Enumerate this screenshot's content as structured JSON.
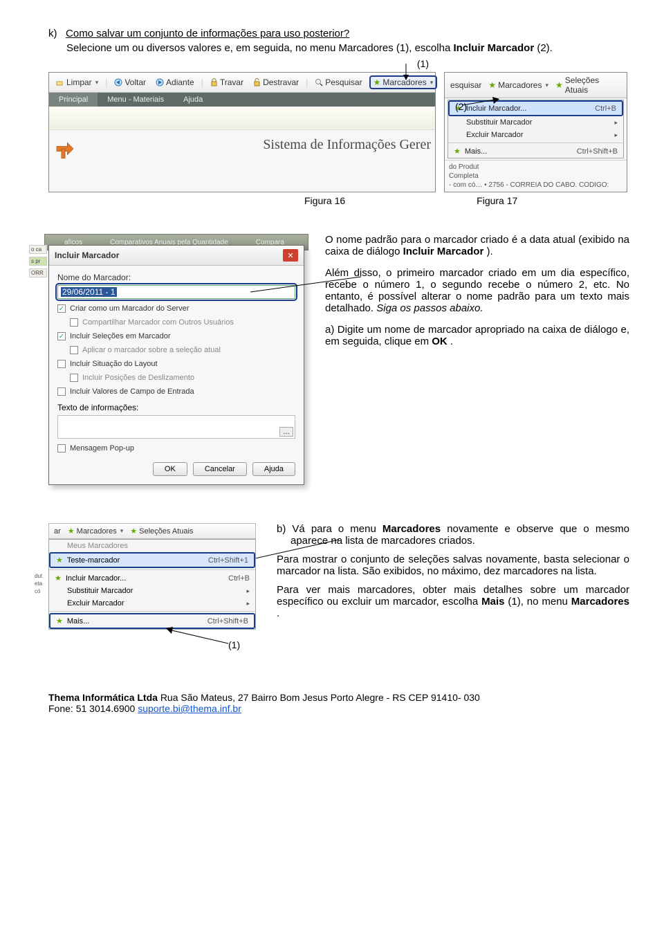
{
  "heading": {
    "k": "k)",
    "title": "Como salvar um conjunto de informações para uso posterior?",
    "intro_pre": "Selecione um ou diversos valores e, em seguida, no menu Marcadores (1), escolha ",
    "intro_bold": "Incluir Marcador",
    "intro_post": " (2)."
  },
  "callouts": {
    "c1": "(1)",
    "c2": "(2)"
  },
  "fig16": {
    "toolbar": {
      "limpar": "Limpar",
      "voltar": "Voltar",
      "adiante": "Adiante",
      "travar": "Travar",
      "destravar": "Destravar",
      "pesquisar": "Pesquisar",
      "marcadores": "Marcadores"
    },
    "tabs": {
      "principal": "Principal",
      "menu_mat": "Menu - Materiais",
      "ajuda": "Ajuda"
    },
    "sys_title": "Sistema de Informações Gerer",
    "caption": "Figura 16"
  },
  "fig17": {
    "top": {
      "pesquisar": "esquisar",
      "marcadores": "Marcadores",
      "selecoes": "Seleções Atuais"
    },
    "items": {
      "incluir": "Incluir Marcador...",
      "incluir_sc": "Ctrl+B",
      "substituir": "Substituir Marcador",
      "excluir": "Excluir Marcador",
      "mais": "Mais...",
      "mais_sc": "Ctrl+Shift+B"
    },
    "below": {
      "l1": "do Produt",
      "l2": "Completa",
      "l3": "- com có…    • 2756 - CORREIA DO CABO. CODIGO:"
    },
    "caption": "Figura 17"
  },
  "dialog": {
    "bg_tabs": {
      "t1": "aficos",
      "t2": "Comparativos Anuais pela Quantidade",
      "t3": "Compara"
    },
    "title": "Incluir Marcador",
    "name_label": "Nome do Marcador:",
    "name_value": "29/06/2011 - 1",
    "chk_server": "Criar como um Marcador do Server",
    "chk_share": "Compartilhar Marcador com Outros Usuários",
    "chk_sel": "Incluir Seleções em Marcador",
    "chk_apply": "Aplicar o marcador sobre a seleção atual",
    "chk_layout": "Incluir Situação do Layout",
    "chk_slide": "Incluir Posições de Deslizamento",
    "chk_entry": "Incluir Valores de Campo de Entrada",
    "info_label": "Texto de informações:",
    "chk_popup": "Mensagem Pop-up",
    "btn_ok": "OK",
    "btn_cancel": "Cancelar",
    "btn_help": "Ajuda",
    "strip": {
      "a": "o ca",
      "b": "s pr",
      "c": "ORR"
    }
  },
  "right_mid": {
    "p1_a": "O nome padrão para o marcador criado é a data atual (exibido na caixa de diálogo ",
    "p1_b": "Incluir Marcador",
    "p1_c": ").",
    "p2_a": "Além disso, o primeiro marcador criado em um dia específico, recebe o número 1, o segundo recebe o número 2, etc. No entanto, é possível alterar o nome padrão para um texto mais detalhado. ",
    "p2_b": "Siga os passos abaixo.",
    "p3_a": "a) Digite um nome de marcador apropriado na caixa de diálogo e, em seguida, clique em ",
    "p3_b": "OK",
    "p3_c": "."
  },
  "menu2": {
    "top": {
      "ar": "ar",
      "marcadores": "Marcadores",
      "selecoes": "Seleções Atuais"
    },
    "items": {
      "meus": "Meus Marcadores",
      "teste": "Teste-marcador",
      "teste_sc": "Ctrl+Shift+1",
      "incluir": "Incluir Marcador...",
      "incluir_sc": "Ctrl+B",
      "substituir": "Substituir Marcador",
      "excluir": "Excluir Marcador",
      "mais": "Mais...",
      "mais_sc": "Ctrl+Shift+B"
    },
    "side": {
      "a": "dut",
      "b": "eta",
      "c": "có"
    },
    "callout1": "(1)"
  },
  "right_low": {
    "pb_pre": "b) Vá para o menu ",
    "pb_b": "Marcadores",
    "pb_post": " novamente e observe que o mesmo aparece na lista de marcadores criados.",
    "p2": "Para mostrar o conjunto de seleções salvas novamente, basta selecionar o marcador na lista. São exibidos, no máximo, dez marcadores na lista.",
    "p3_a": "Para ver mais marcadores, obter mais detalhes sobre um marcador específico ou excluir um marcador, escolha ",
    "p3_b": "Mais",
    "p3_c": " (1), no menu ",
    "p3_d": "Marcadores",
    "p3_e": "."
  },
  "footer": {
    "line1_a": "Thema Informática Ltda",
    "line1_b": "   Rua São Mateus, 27  Bairro Bom Jesus  Porto Alegre - RS CEP 91410- 030",
    "line2_a": "Fone: 51 3014.6900  ",
    "line2_link": "suporte.bi@thema.inf.br"
  }
}
